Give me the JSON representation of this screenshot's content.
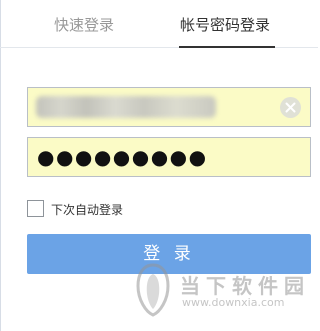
{
  "tabs": {
    "quick_login": "快速登录",
    "account_login": "帐号密码登录",
    "active": "account_login"
  },
  "form": {
    "username_value": "",
    "password_mask": "●●●●●●●●●",
    "remember_label": "下次自动登录",
    "remember_checked": false,
    "login_button": "登 录"
  },
  "watermark": {
    "brand": "当下软件园",
    "url": "www.downxia.com"
  },
  "colors": {
    "input_background": "#fbfbc6",
    "button_background": "#6ba3e6",
    "active_tab_underline": "#333333"
  },
  "icons": {
    "clear": "close-circle-icon",
    "watermark_logo": "downxia-logo-icon"
  }
}
